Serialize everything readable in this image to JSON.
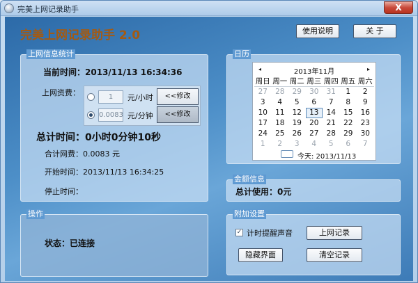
{
  "window": {
    "title": "完美上网记录助手",
    "close_label": "X"
  },
  "app": {
    "title": "完美上网记录助手 2.0"
  },
  "header_buttons": {
    "help": "使用说明",
    "about": "关 于"
  },
  "stats": {
    "group_title": "上网信息统计",
    "current_time_label": "当前时间：2013/11/13 16:34:36",
    "fee_label": "上网资费：",
    "rates": [
      {
        "value": "1",
        "unit": "元/小时",
        "button": "<<修改",
        "selected": false
      },
      {
        "value": "0.0083",
        "unit": "元/分钟",
        "button": "<<修改",
        "selected": true
      }
    ],
    "total_time": "总计时间：0小时0分钟10秒",
    "total_fee": "合计网费：0.0083 元",
    "start_time": "开始时间：2013/11/13 16:34:25",
    "stop_time": "停止时间："
  },
  "ops": {
    "group_title": "操作",
    "status": "状态：已连接"
  },
  "calendar": {
    "group_title": "日历",
    "prev": "◂",
    "next": "▸",
    "month_label": "2013年11月",
    "weekdays": [
      "周日",
      "周一",
      "周二",
      "周三",
      "周四",
      "周五",
      "周六"
    ],
    "weeks": [
      [
        "27",
        "28",
        "29",
        "30",
        "31",
        "1",
        "2"
      ],
      [
        "3",
        "4",
        "5",
        "6",
        "7",
        "8",
        "9"
      ],
      [
        "10",
        "11",
        "12",
        "13",
        "14",
        "15",
        "16"
      ],
      [
        "17",
        "18",
        "19",
        "20",
        "21",
        "22",
        "23"
      ],
      [
        "24",
        "25",
        "26",
        "27",
        "28",
        "29",
        "30"
      ],
      [
        "1",
        "2",
        "3",
        "4",
        "5",
        "6",
        "7"
      ]
    ],
    "today_label": "今天: 2013/11/13"
  },
  "money": {
    "group_title": "金额信息",
    "total": "总计使用：0元"
  },
  "extra": {
    "group_title": "附加设置",
    "sound_label": "计时提醒声音",
    "sound_checked": true,
    "log_button": "上网记录",
    "hide_button": "隐藏界面",
    "clear_button": "清空记录"
  },
  "colors": {
    "title_accent": "#a45a12"
  }
}
